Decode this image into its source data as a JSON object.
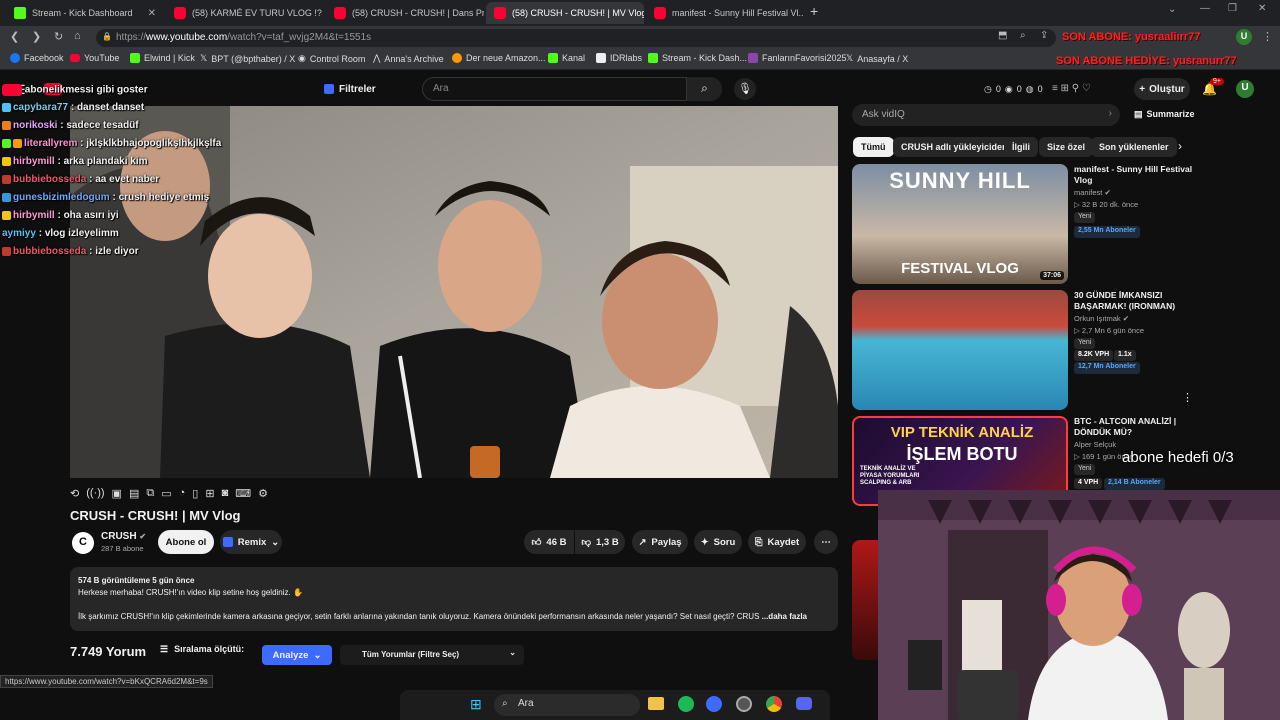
{
  "tabs": [
    {
      "title": "Stream - Kick Dashboard",
      "icon": "kick"
    },
    {
      "title": "(58) KARMÉ EV TURU VLOG !? | ...",
      "icon": "youtube"
    },
    {
      "title": "(58) CRUSH - CRUSH! | Dans Pr...",
      "icon": "youtube"
    },
    {
      "title": "(58) CRUSH - CRUSH! | MV Vlog",
      "icon": "youtube"
    },
    {
      "title": "manifest - Sunny Hill Festival Vl...",
      "icon": "youtube"
    }
  ],
  "browser": {
    "url_prefix": "https://",
    "url_host": "www.youtube.com",
    "url_rest": "/watch?v=taf_wvjg2M4&t=1551s",
    "status_url": "https://www.youtube.com/watch?v=bKxQCRA6d2M&t=9s"
  },
  "bookmarks": [
    "Facebook",
    "YouTube",
    "Elwind | Kick",
    "BPT (@bpthaber) / X",
    "Control Room",
    "Anna's Archive",
    "Der neue Amazon...",
    "Kanal",
    "IDRlabs",
    "Stream - Kick Dash...",
    "FanlarınFavorisi2025",
    "Anasayfa / X"
  ],
  "overlay": {
    "last_sub": "SON ABONE: yusraaliırr77",
    "last_sub_gift": "SON ABONE HEDİYE: yusranurr77",
    "sub_goal": "abone hedefi 0/3"
  },
  "chat": [
    {
      "user": "",
      "msg": "abonelikmessi gibi goster",
      "color": "#ffffff"
    },
    {
      "user": "capybara77",
      "msg": "danset danset",
      "color": "#7ec8e3"
    },
    {
      "user": "norikoski",
      "msg": "sadece tesadüf",
      "color": "#e8a0ff"
    },
    {
      "user": "literallyrem",
      "msg": "jklşklkbhajopoglikşlhkjlkşlfa",
      "color": "#ff8fd0"
    },
    {
      "user": "hirbymill",
      "msg": "arka plandaki kim",
      "color": "#ff9ad5"
    },
    {
      "user": "bubbiebosseda",
      "msg": "aa evet naber",
      "color": "#ff4d6d"
    },
    {
      "user": "gunesbizimledogum",
      "msg": "crush hediye etmiş",
      "color": "#6fa8ff"
    },
    {
      "user": "hirbymill",
      "msg": "oha asırı iyi",
      "color": "#ff9ad5"
    },
    {
      "user": "aymiyy",
      "msg": "vlog izleyelimm",
      "color": "#4fc3f7"
    },
    {
      "user": "bubbiebosseda",
      "msg": "izle diyor",
      "color": "#ff4d6d"
    }
  ],
  "yt": {
    "filters_label": "Filtreler",
    "search_placeholder": "Ara",
    "create_label": "Oluştur",
    "notif_count": "9+",
    "avatar_letter": "U",
    "counters": [
      "0",
      "0",
      "0"
    ]
  },
  "video": {
    "title": "CRUSH - CRUSH! | MV Vlog",
    "channel": "CRUSH",
    "channel_subs": "287 B abone",
    "subscribe": "Abone ol",
    "remix": "Remix",
    "likes": "46 B",
    "dislikes": "1,3 B",
    "share": "Paylaş",
    "ask": "Soru",
    "save": "Kaydet",
    "views_line": "574 B görüntüleme  5 gün önce",
    "desc1": "Herkese merhaba! CRUSH!'ın video klip setine hoş geldiniz. ✋",
    "desc2": "İlk şarkımız CRUSH!'ın klip çekimlerinde kamera arkasına geçiyor, setin farklı anlarına yakından tanık oluyoruz. Kamera önündeki performansın arkasında neler yaşandı? Set nasıl geçti? CRUS",
    "more": "...daha fazla",
    "comments_count": "7.749 Yorum",
    "sort_label": "Sıralama ölçütü:",
    "analyze": "Analyze",
    "all_comments": "Tüm Yorumlar (Filtre Seç)"
  },
  "sidebar": {
    "ask_placeholder": "Ask vidIQ",
    "summarize": "Summarize",
    "chips": [
      "Tümü",
      "CRUSH adlı yükleyiciden",
      "İlgili",
      "Size özel",
      "Son yüklenenler"
    ],
    "videos": [
      {
        "title": "manifest - Sunny Hill Festival Vlog",
        "channel": "manifest",
        "meta": "32 B  20 dk. önce",
        "tag": "Yeni",
        "subs": "2,55 Mn Aboneler",
        "duration": "37:06",
        "thumb_text1": "SUNNY HILL",
        "thumb_text2": "FESTIVAL VLOG"
      },
      {
        "title": "30 GÜNDE İMKANSIZI BAŞARMAK! (IRONMAN)",
        "channel": "Orkun Işıtmak",
        "meta": "2,7 Mn  6 gün önce",
        "tag": "Yeni",
        "vph": "8.2K VPH",
        "mult": "1.1x",
        "subs": "12,7 Mn Aboneler"
      },
      {
        "title": "BTC - ALTCOIN ANALİZİ | DÖNDÜK MÜ?",
        "channel": "Alper Selçuk",
        "meta": "169  1 gün önce",
        "tag": "Yeni",
        "vph": "4 VPH",
        "subs": "2,14 B Aboneler",
        "thumb_text1": "VIP TEKNİK ANALİZ",
        "thumb_text2": "İŞLEM BOTU",
        "thumb_text3": "TEKNİK ANALİZ VE PİYASA YORUMLARI SCALPING & ARB"
      }
    ]
  },
  "taskbar": {
    "search": "Ara"
  },
  "colors": {
    "kick": "#53fc18",
    "youtube": "#ff0033",
    "vidiq": "#3d6bff",
    "overlay_red": "#ff2020"
  }
}
